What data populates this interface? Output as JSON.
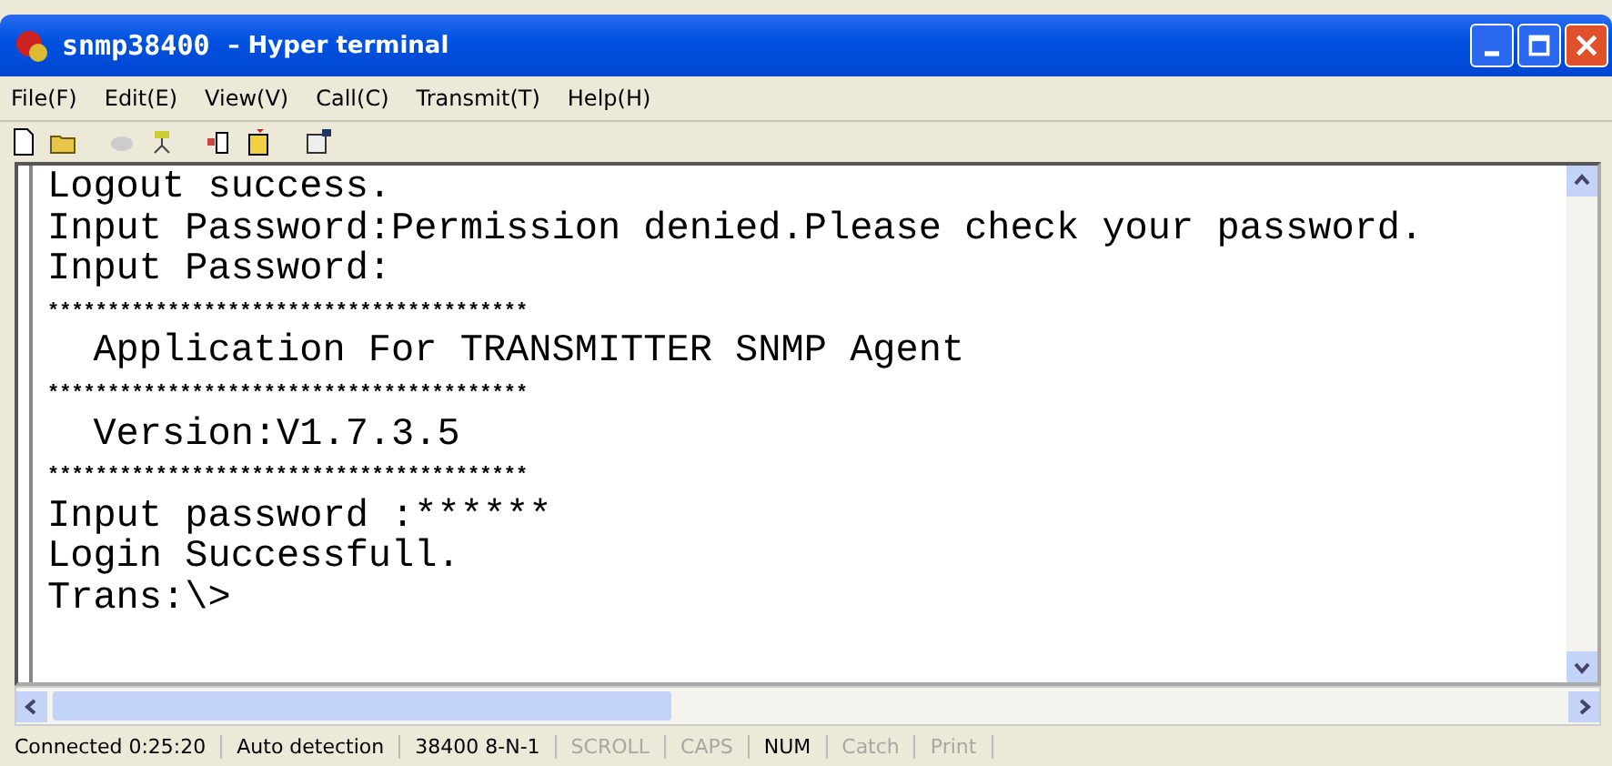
{
  "window": {
    "title": "snmp38400",
    "subtitle": "– Hyper terminal"
  },
  "menu": [
    "File(F)",
    "Edit(E)",
    "View(V)",
    "Call(C)",
    "Transmit(T)",
    "Help(H)"
  ],
  "terminal": {
    "lines": [
      {
        "kind": "text",
        "text": "Logout success."
      },
      {
        "kind": "text",
        "text": "Input Password:Permission denied.Please check your password."
      },
      {
        "kind": "text",
        "text": "Input Password:"
      },
      {
        "kind": "stars",
        "text": "****************************************"
      },
      {
        "kind": "text",
        "text": "  Application For TRANSMITTER SNMP Agent"
      },
      {
        "kind": "stars",
        "text": "****************************************"
      },
      {
        "kind": "text",
        "text": "  Version:V1.7.3.5"
      },
      {
        "kind": "stars",
        "text": "****************************************"
      },
      {
        "kind": "text",
        "text": "Input password :******"
      },
      {
        "kind": "text",
        "text": "Login Successfull."
      },
      {
        "kind": "text",
        "text": "Trans:\\>"
      }
    ]
  },
  "status_bar": [
    {
      "text": "Connected 0:25:20",
      "on": true
    },
    {
      "text": "Auto detection",
      "on": true
    },
    {
      "text": "38400 8-N-1",
      "on": true
    },
    {
      "text": "SCROLL",
      "on": false
    },
    {
      "text": "CAPS",
      "on": false
    },
    {
      "text": "NUM",
      "on": true
    },
    {
      "text": "Catch",
      "on": false
    },
    {
      "text": "Print",
      "on": false
    }
  ]
}
